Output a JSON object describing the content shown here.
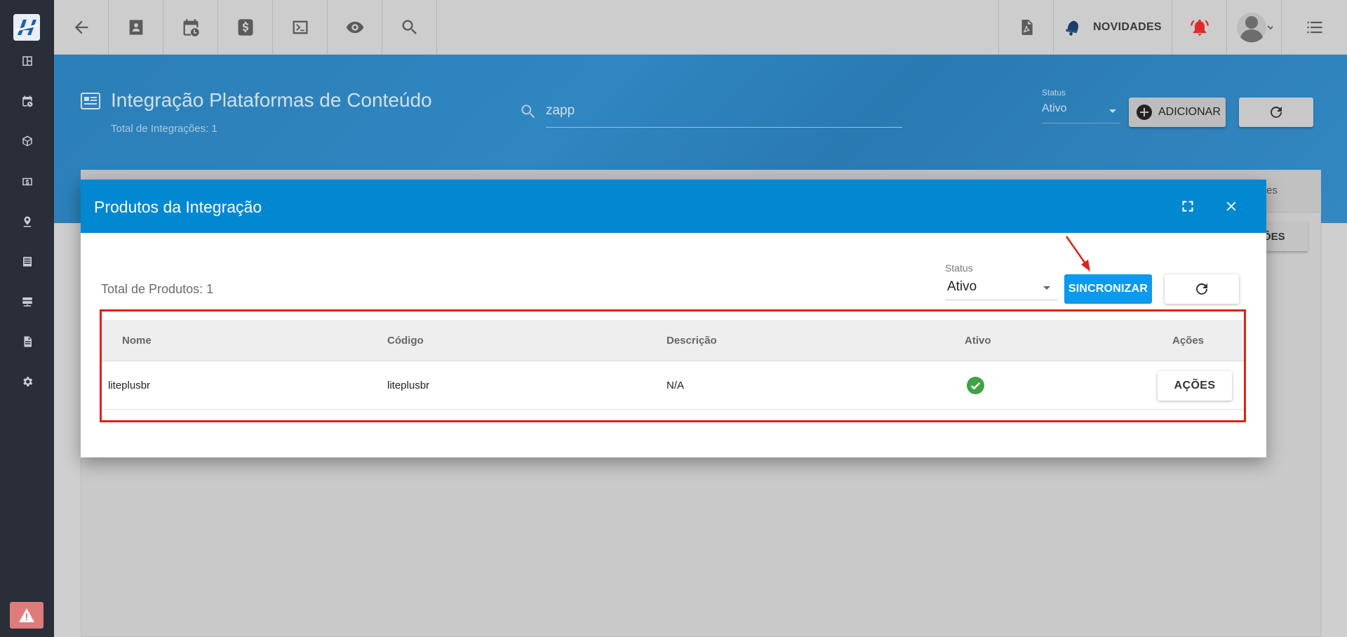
{
  "topbar": {
    "novidades_label": "NOVIDADES"
  },
  "header": {
    "title": "Integração Plataformas de Conteúdo",
    "subtitle": "Total de Integrações: 1",
    "search_value": "zapp",
    "status_label": "Status",
    "status_value": "Ativo",
    "add_label": "ADICIONAR"
  },
  "background": {
    "fragment_top": "es",
    "fragment_button": "ÕES"
  },
  "modal": {
    "title": "Produtos da Integração",
    "total_label": "Total de Produtos: 1",
    "status_label": "Status",
    "status_value": "Ativo",
    "sync_label": "SINCRONIZAR",
    "table": {
      "columns": [
        "Nome",
        "Código",
        "Descrição",
        "Ativo",
        "Ações"
      ],
      "rows": [
        {
          "nome": "liteplusbr",
          "codigo": "liteplusbr",
          "descricao": "N/A",
          "ativo": true,
          "acoes_label": "AÇÕES"
        }
      ]
    }
  },
  "colors": {
    "accent": "#0288d1",
    "sync": "#0b9aed",
    "annotation": "#e0201a",
    "active_check": "#43a047"
  }
}
